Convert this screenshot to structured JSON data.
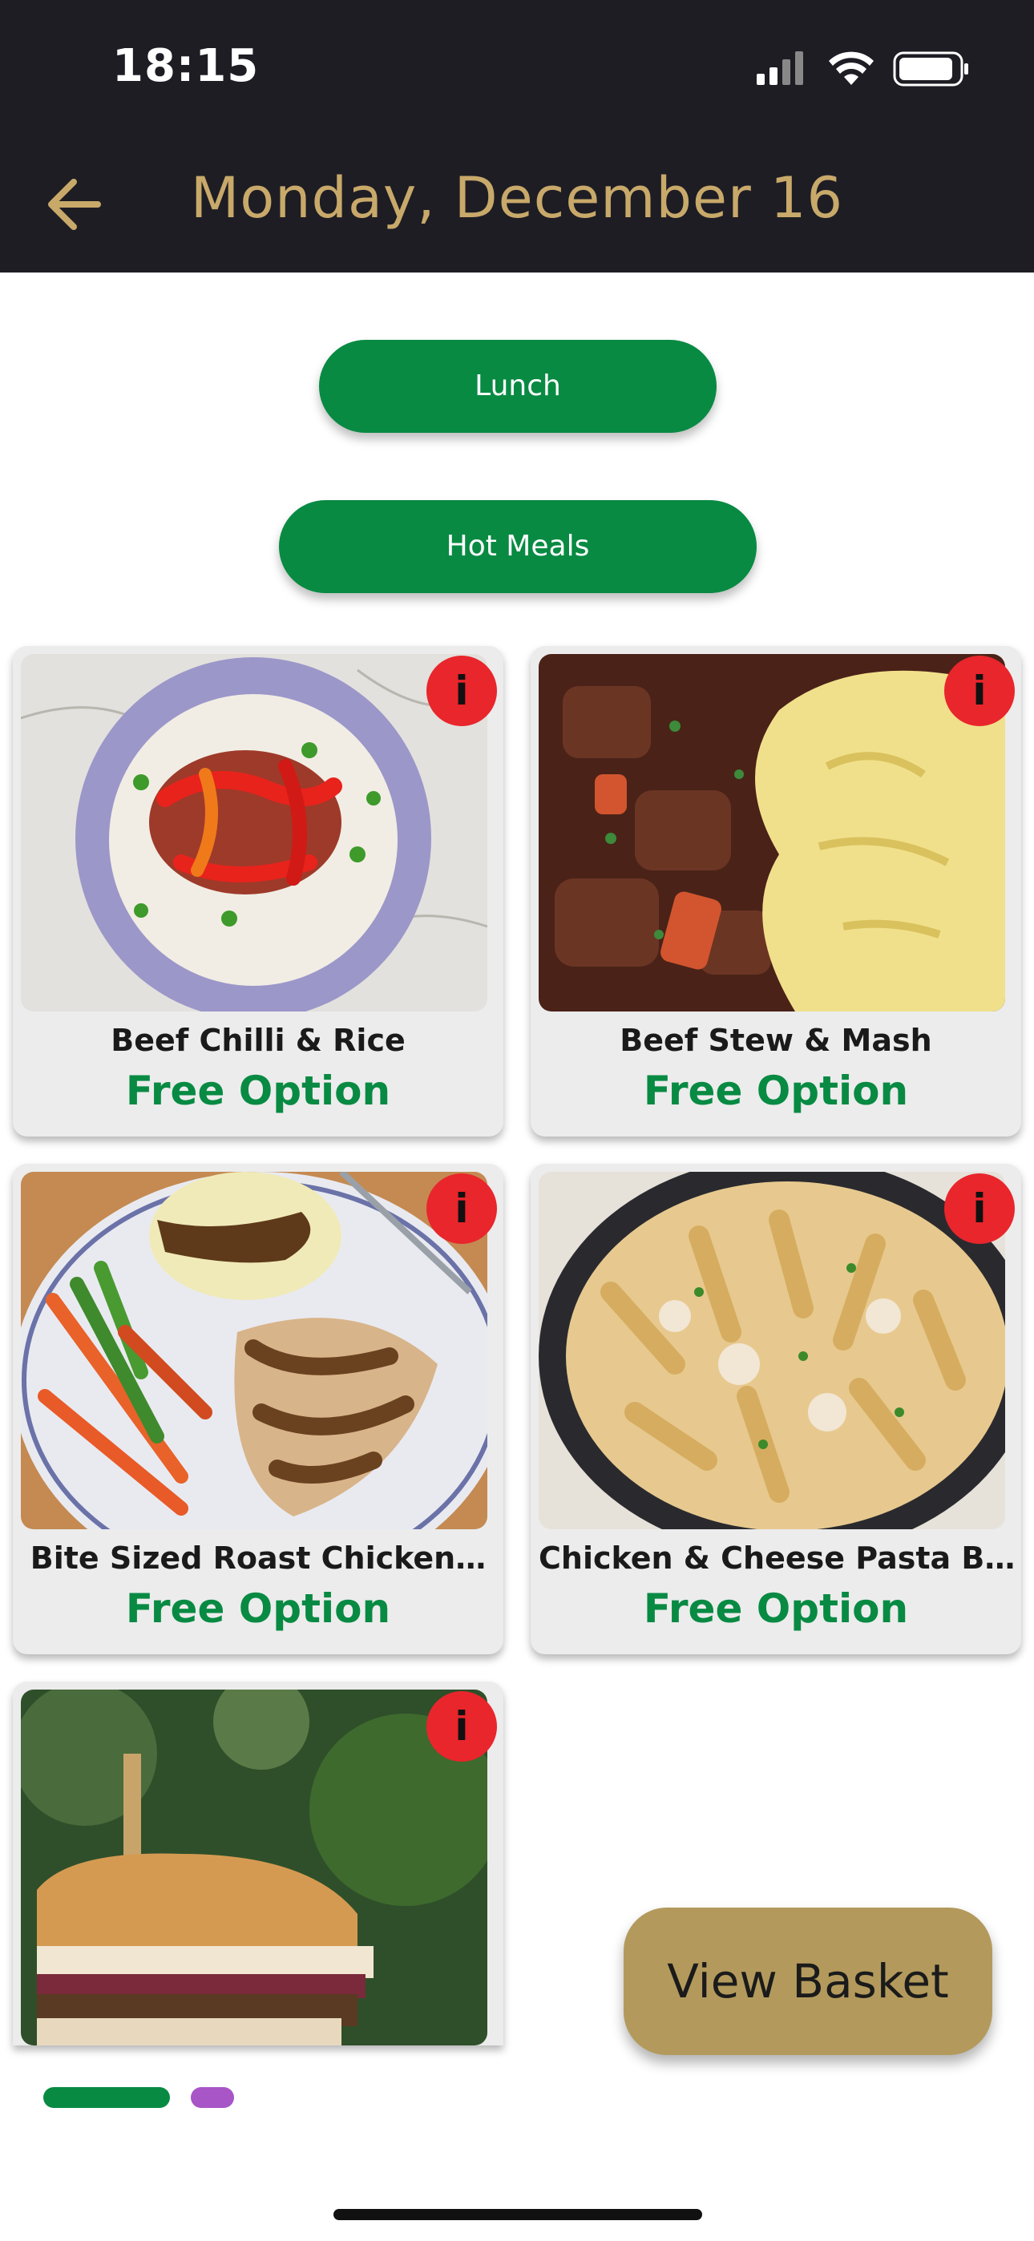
{
  "status_bar": {
    "time": "18:15"
  },
  "header": {
    "title": "Monday, December 16"
  },
  "filters": {
    "meal_period": "Lunch",
    "category": "Hot Meals"
  },
  "menu_items": [
    {
      "name": "Beef Chilli & Rice",
      "price": "Free Option"
    },
    {
      "name": "Beef Stew & Mash",
      "price": "Free Option"
    },
    {
      "name": "Bite Sized Roast Chicken…",
      "price": "Free Option"
    },
    {
      "name": "Chicken & Cheese Pasta B…",
      "price": "Free Option"
    },
    {
      "name": "",
      "price": ""
    }
  ],
  "info_label": "i",
  "basket": {
    "label": "View Basket"
  },
  "colors": {
    "brand_green": "#088a43",
    "gold": "#c8a96a",
    "basket_gold": "#b39a5c",
    "header_bg": "#1e1d24",
    "info_red": "#e8262c",
    "indicator_purple": "#a855c7"
  },
  "icons": [
    "back-arrow-icon",
    "signal-icon",
    "wifi-icon",
    "battery-icon",
    "info-icon"
  ]
}
